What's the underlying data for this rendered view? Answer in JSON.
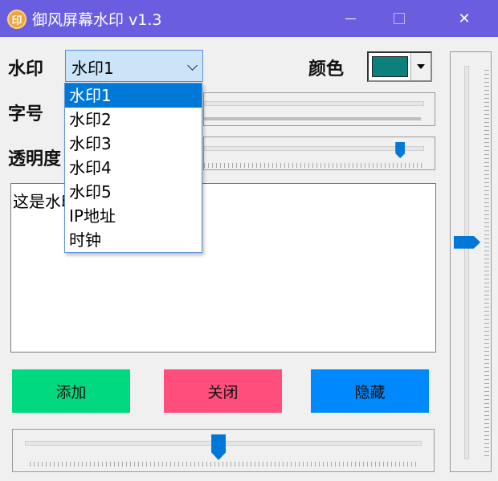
{
  "window": {
    "title": "御风屏幕水印 v1.3",
    "icon_text": "印",
    "minimize": "minimize",
    "maximize": "maximize",
    "close": "✕"
  },
  "form": {
    "watermark_label": "水印",
    "watermark_value": "水印1",
    "color_label": "颜色",
    "color_value": "#0b807c",
    "fontsize_label": "字号",
    "opacity_label": "透明度",
    "text_content": "这是水印1"
  },
  "dropdown": {
    "options": [
      "水印1",
      "水印2",
      "水印3",
      "水印4",
      "水印5",
      "IP地址",
      "时钟"
    ],
    "selected_index": 0
  },
  "sliders": {
    "opacity_level": 0.92,
    "bottom_level": 0.49,
    "right_level": 0.45
  },
  "buttons": {
    "add": "添加",
    "close": "关闭",
    "hide": "隐藏"
  },
  "colors": {
    "title_bar": "#6a5ee0",
    "add_button": "#00d97f",
    "close_button": "#ff4e7c",
    "hide_button": "#0089ff",
    "accent": "#0078d7"
  }
}
